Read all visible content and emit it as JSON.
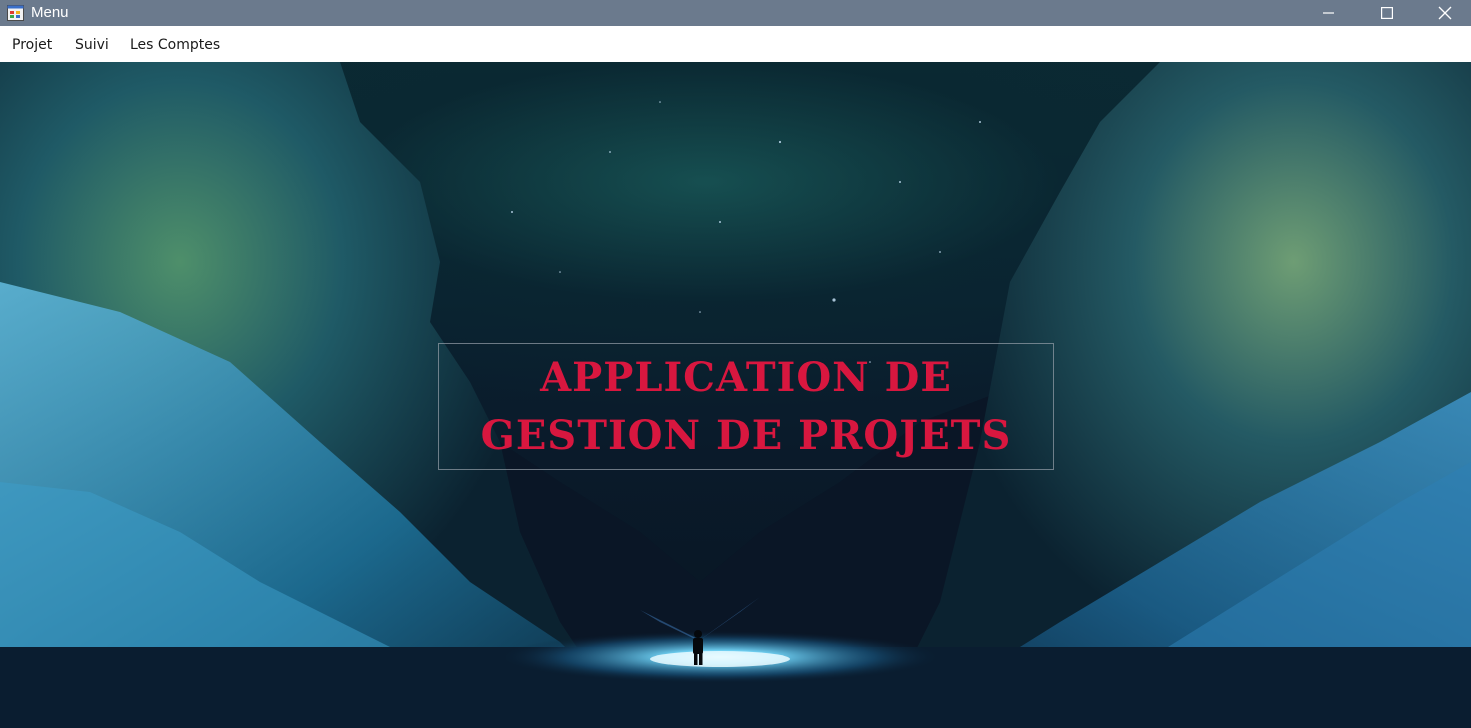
{
  "window": {
    "title": "Menu",
    "icon": "app-form-icon",
    "controls": [
      "minimize-icon",
      "maximize-icon",
      "close-icon"
    ]
  },
  "menu": {
    "items": [
      {
        "label": "Projet"
      },
      {
        "label": "Suivi"
      },
      {
        "label": "Les Comptes"
      }
    ]
  },
  "main": {
    "title_line1": "APPLICATION DE",
    "title_line2": "GESTION DE PROJETS",
    "title_color": "#d8173f"
  }
}
